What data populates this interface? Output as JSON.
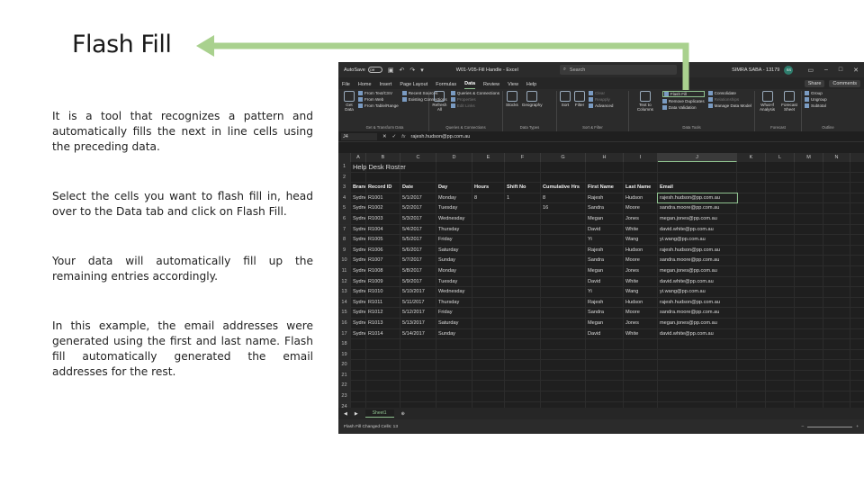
{
  "slide": {
    "title": "Flash Fill",
    "paragraphs": [
      "It is a tool that recognizes a pattern and automatically fills the next in line cells using the preceding data.",
      "Select the cells you want to flash fill in, head over to the Data tab and click on Flash Fill.",
      "Your data will automatically fill up the remaining entries accordingly.",
      "In this example, the email addresses were generated using the first and last name. Flash fill automatically generated the email addresses for the rest."
    ],
    "arrow_color": "#a9d18e"
  },
  "excel": {
    "autosave_label": "AutoSave",
    "autosave_state": "Off",
    "window_title": "W01-V05-Fill Handle - Excel",
    "search_placeholder": "Search",
    "user_name": "SIMRA SABA - 13179",
    "user_initials": "SS",
    "menu": [
      "File",
      "Home",
      "Insert",
      "Page Layout",
      "Formulas",
      "Data",
      "Review",
      "View",
      "Help"
    ],
    "active_menu": "Data",
    "share_label": "Share",
    "comments_label": "Comments",
    "ribbon": {
      "get_data": "Get Data",
      "from_text": "From Text/CSV",
      "from_web": "From Web",
      "from_table": "From Table/Range",
      "recent_sources": "Recent Sources",
      "existing_connections": "Existing Connections",
      "group1": "Get & Transform Data",
      "refresh_all": "Refresh All",
      "queries_connections": "Queries & Connections",
      "properties": "Properties",
      "edit_links": "Edit Links",
      "group2": "Queries & Connections",
      "stocks": "Stocks",
      "geography": "Geography",
      "group3": "Data Types",
      "sort": "Sort",
      "filter": "Filter",
      "clear": "Clear",
      "reapply": "Reapply",
      "advanced": "Advanced",
      "group4": "Sort & Filter",
      "text_to_columns": "Text to Columns",
      "flash_fill": "Flash Fill",
      "remove_duplicates": "Remove Duplicates",
      "data_validation": "Data Validation",
      "consolidate": "Consolidate",
      "relationships": "Relationships",
      "manage_data_model": "Manage Data Model",
      "group5": "Data Tools",
      "what_if": "What-If Analysis",
      "forecast_sheet": "Forecast Sheet",
      "group6": "Forecast",
      "group_btn": "Group",
      "ungroup": "Ungroup",
      "subtotal": "Subtotal",
      "group7": "Outline"
    },
    "name_box": "J4",
    "formula": "rajesh.hudson@pp.com.au",
    "columns": [
      "A",
      "B",
      "C",
      "D",
      "E",
      "F",
      "G",
      "H",
      "I",
      "J",
      "K",
      "L",
      "M",
      "N"
    ],
    "sheet_title": "Help Desk Roster",
    "headers": [
      "Branch",
      "Record ID",
      "Date",
      "Day",
      "Hours",
      "Shift No",
      "Cumulative Hrs",
      "First Name",
      "Last Name",
      "Email"
    ],
    "data_rows": [
      [
        "Sydney",
        "R1001",
        "5/1/2017",
        "Monday",
        "8",
        "1",
        "8",
        "Rajesh",
        "Hudson",
        "rajesh.hudson@pp.com.au"
      ],
      [
        "Sydney",
        "R1002",
        "5/2/2017",
        "Tuesday",
        "",
        "",
        "16",
        "Sandra",
        "Moore",
        "sandra.moore@pp.com.au"
      ],
      [
        "Sydney",
        "R1003",
        "5/3/2017",
        "Wednesday",
        "",
        "",
        "",
        "Megan",
        "Jones",
        "megan.jones@pp.com.au"
      ],
      [
        "Sydney",
        "R1004",
        "5/4/2017",
        "Thursday",
        "",
        "",
        "",
        "David",
        "White",
        "david.white@pp.com.au"
      ],
      [
        "Sydney",
        "R1005",
        "5/5/2017",
        "Friday",
        "",
        "",
        "",
        "Yi",
        "Wang",
        "yi.wang@pp.com.au"
      ],
      [
        "Sydney",
        "R1006",
        "5/6/2017",
        "Saturday",
        "",
        "",
        "",
        "Rajesh",
        "Hudson",
        "rajesh.hudson@pp.com.au"
      ],
      [
        "Sydney",
        "R1007",
        "5/7/2017",
        "Sunday",
        "",
        "",
        "",
        "Sandra",
        "Moore",
        "sandra.moore@pp.com.au"
      ],
      [
        "Sydney",
        "R1008",
        "5/8/2017",
        "Monday",
        "",
        "",
        "",
        "Megan",
        "Jones",
        "megan.jones@pp.com.au"
      ],
      [
        "Sydney",
        "R1009",
        "5/9/2017",
        "Tuesday",
        "",
        "",
        "",
        "David",
        "White",
        "david.white@pp.com.au"
      ],
      [
        "Sydney",
        "R1010",
        "5/10/2017",
        "Wednesday",
        "",
        "",
        "",
        "Yi",
        "Wang",
        "yi.wang@pp.com.au"
      ],
      [
        "Sydney",
        "R1011",
        "5/11/2017",
        "Thursday",
        "",
        "",
        "",
        "Rajesh",
        "Hudson",
        "rajesh.hudson@pp.com.au"
      ],
      [
        "Sydney",
        "R1012",
        "5/12/2017",
        "Friday",
        "",
        "",
        "",
        "Sandra",
        "Moore",
        "sandra.moore@pp.com.au"
      ],
      [
        "Sydney",
        "R1013",
        "5/13/2017",
        "Saturday",
        "",
        "",
        "",
        "Megan",
        "Jones",
        "megan.jones@pp.com.au"
      ],
      [
        "Sydney",
        "R1014",
        "5/14/2017",
        "Sunday",
        "",
        "",
        "",
        "David",
        "White",
        "david.white@pp.com.au"
      ]
    ],
    "row_numbers": [
      "1",
      "2",
      "3",
      "4",
      "5",
      "6",
      "7",
      "8",
      "9",
      "10",
      "11",
      "12",
      "13",
      "14",
      "15",
      "16",
      "17",
      "18",
      "19",
      "20",
      "21",
      "22",
      "23",
      "24"
    ],
    "sheet_tab": "Sheet1",
    "status_text": "Flash Fill Changed Cells: 13",
    "accent_color": "#8fc28f"
  }
}
